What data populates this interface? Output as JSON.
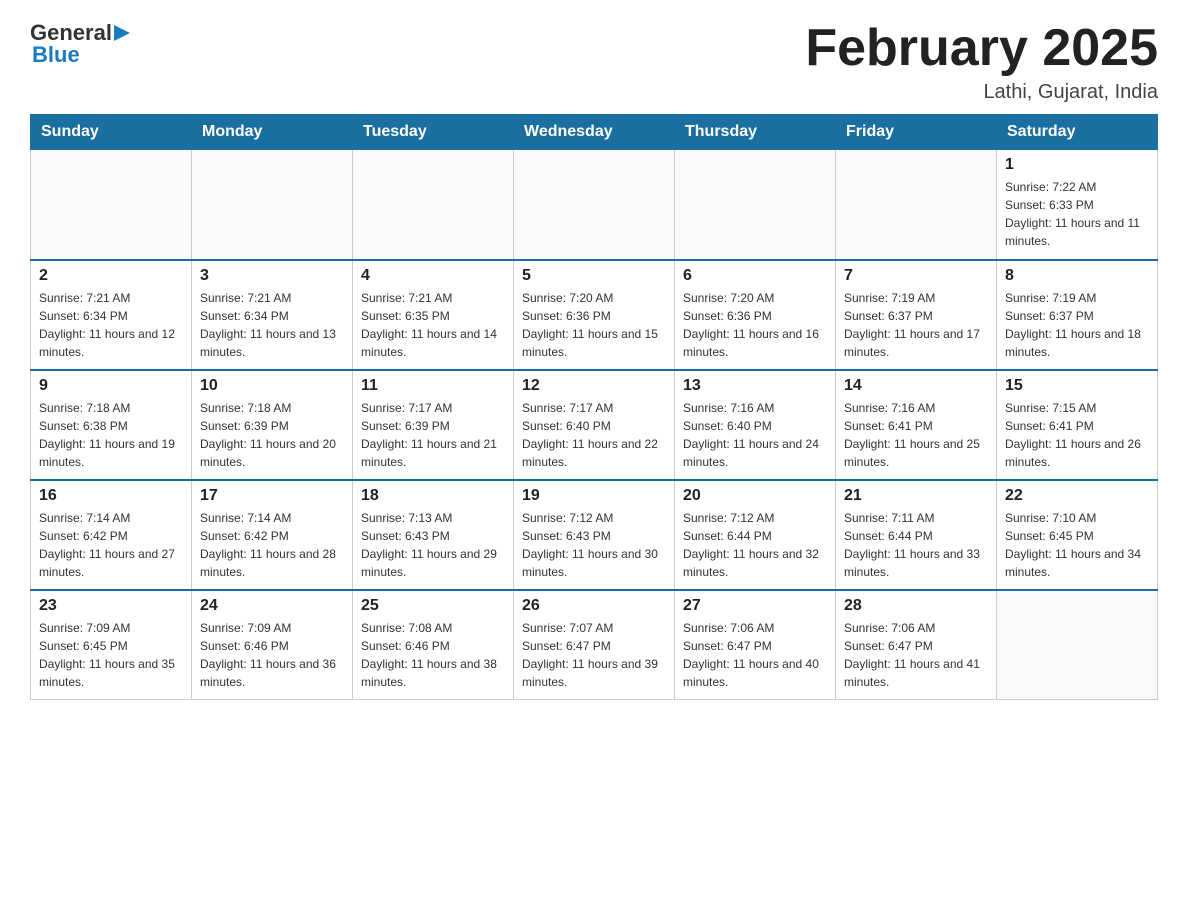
{
  "header": {
    "logo": {
      "general": "General",
      "blue": "Blue",
      "arrow": "▶"
    },
    "title": "February 2025",
    "subtitle": "Lathi, Gujarat, India"
  },
  "weekdays": [
    "Sunday",
    "Monday",
    "Tuesday",
    "Wednesday",
    "Thursday",
    "Friday",
    "Saturday"
  ],
  "weeks": [
    [
      {
        "day": "",
        "sunrise": "",
        "sunset": "",
        "daylight": ""
      },
      {
        "day": "",
        "sunrise": "",
        "sunset": "",
        "daylight": ""
      },
      {
        "day": "",
        "sunrise": "",
        "sunset": "",
        "daylight": ""
      },
      {
        "day": "",
        "sunrise": "",
        "sunset": "",
        "daylight": ""
      },
      {
        "day": "",
        "sunrise": "",
        "sunset": "",
        "daylight": ""
      },
      {
        "day": "",
        "sunrise": "",
        "sunset": "",
        "daylight": ""
      },
      {
        "day": "1",
        "sunrise": "Sunrise: 7:22 AM",
        "sunset": "Sunset: 6:33 PM",
        "daylight": "Daylight: 11 hours and 11 minutes."
      }
    ],
    [
      {
        "day": "2",
        "sunrise": "Sunrise: 7:21 AM",
        "sunset": "Sunset: 6:34 PM",
        "daylight": "Daylight: 11 hours and 12 minutes."
      },
      {
        "day": "3",
        "sunrise": "Sunrise: 7:21 AM",
        "sunset": "Sunset: 6:34 PM",
        "daylight": "Daylight: 11 hours and 13 minutes."
      },
      {
        "day": "4",
        "sunrise": "Sunrise: 7:21 AM",
        "sunset": "Sunset: 6:35 PM",
        "daylight": "Daylight: 11 hours and 14 minutes."
      },
      {
        "day": "5",
        "sunrise": "Sunrise: 7:20 AM",
        "sunset": "Sunset: 6:36 PM",
        "daylight": "Daylight: 11 hours and 15 minutes."
      },
      {
        "day": "6",
        "sunrise": "Sunrise: 7:20 AM",
        "sunset": "Sunset: 6:36 PM",
        "daylight": "Daylight: 11 hours and 16 minutes."
      },
      {
        "day": "7",
        "sunrise": "Sunrise: 7:19 AM",
        "sunset": "Sunset: 6:37 PM",
        "daylight": "Daylight: 11 hours and 17 minutes."
      },
      {
        "day": "8",
        "sunrise": "Sunrise: 7:19 AM",
        "sunset": "Sunset: 6:37 PM",
        "daylight": "Daylight: 11 hours and 18 minutes."
      }
    ],
    [
      {
        "day": "9",
        "sunrise": "Sunrise: 7:18 AM",
        "sunset": "Sunset: 6:38 PM",
        "daylight": "Daylight: 11 hours and 19 minutes."
      },
      {
        "day": "10",
        "sunrise": "Sunrise: 7:18 AM",
        "sunset": "Sunset: 6:39 PM",
        "daylight": "Daylight: 11 hours and 20 minutes."
      },
      {
        "day": "11",
        "sunrise": "Sunrise: 7:17 AM",
        "sunset": "Sunset: 6:39 PM",
        "daylight": "Daylight: 11 hours and 21 minutes."
      },
      {
        "day": "12",
        "sunrise": "Sunrise: 7:17 AM",
        "sunset": "Sunset: 6:40 PM",
        "daylight": "Daylight: 11 hours and 22 minutes."
      },
      {
        "day": "13",
        "sunrise": "Sunrise: 7:16 AM",
        "sunset": "Sunset: 6:40 PM",
        "daylight": "Daylight: 11 hours and 24 minutes."
      },
      {
        "day": "14",
        "sunrise": "Sunrise: 7:16 AM",
        "sunset": "Sunset: 6:41 PM",
        "daylight": "Daylight: 11 hours and 25 minutes."
      },
      {
        "day": "15",
        "sunrise": "Sunrise: 7:15 AM",
        "sunset": "Sunset: 6:41 PM",
        "daylight": "Daylight: 11 hours and 26 minutes."
      }
    ],
    [
      {
        "day": "16",
        "sunrise": "Sunrise: 7:14 AM",
        "sunset": "Sunset: 6:42 PM",
        "daylight": "Daylight: 11 hours and 27 minutes."
      },
      {
        "day": "17",
        "sunrise": "Sunrise: 7:14 AM",
        "sunset": "Sunset: 6:42 PM",
        "daylight": "Daylight: 11 hours and 28 minutes."
      },
      {
        "day": "18",
        "sunrise": "Sunrise: 7:13 AM",
        "sunset": "Sunset: 6:43 PM",
        "daylight": "Daylight: 11 hours and 29 minutes."
      },
      {
        "day": "19",
        "sunrise": "Sunrise: 7:12 AM",
        "sunset": "Sunset: 6:43 PM",
        "daylight": "Daylight: 11 hours and 30 minutes."
      },
      {
        "day": "20",
        "sunrise": "Sunrise: 7:12 AM",
        "sunset": "Sunset: 6:44 PM",
        "daylight": "Daylight: 11 hours and 32 minutes."
      },
      {
        "day": "21",
        "sunrise": "Sunrise: 7:11 AM",
        "sunset": "Sunset: 6:44 PM",
        "daylight": "Daylight: 11 hours and 33 minutes."
      },
      {
        "day": "22",
        "sunrise": "Sunrise: 7:10 AM",
        "sunset": "Sunset: 6:45 PM",
        "daylight": "Daylight: 11 hours and 34 minutes."
      }
    ],
    [
      {
        "day": "23",
        "sunrise": "Sunrise: 7:09 AM",
        "sunset": "Sunset: 6:45 PM",
        "daylight": "Daylight: 11 hours and 35 minutes."
      },
      {
        "day": "24",
        "sunrise": "Sunrise: 7:09 AM",
        "sunset": "Sunset: 6:46 PM",
        "daylight": "Daylight: 11 hours and 36 minutes."
      },
      {
        "day": "25",
        "sunrise": "Sunrise: 7:08 AM",
        "sunset": "Sunset: 6:46 PM",
        "daylight": "Daylight: 11 hours and 38 minutes."
      },
      {
        "day": "26",
        "sunrise": "Sunrise: 7:07 AM",
        "sunset": "Sunset: 6:47 PM",
        "daylight": "Daylight: 11 hours and 39 minutes."
      },
      {
        "day": "27",
        "sunrise": "Sunrise: 7:06 AM",
        "sunset": "Sunset: 6:47 PM",
        "daylight": "Daylight: 11 hours and 40 minutes."
      },
      {
        "day": "28",
        "sunrise": "Sunrise: 7:06 AM",
        "sunset": "Sunset: 6:47 PM",
        "daylight": "Daylight: 11 hours and 41 minutes."
      },
      {
        "day": "",
        "sunrise": "",
        "sunset": "",
        "daylight": ""
      }
    ]
  ]
}
